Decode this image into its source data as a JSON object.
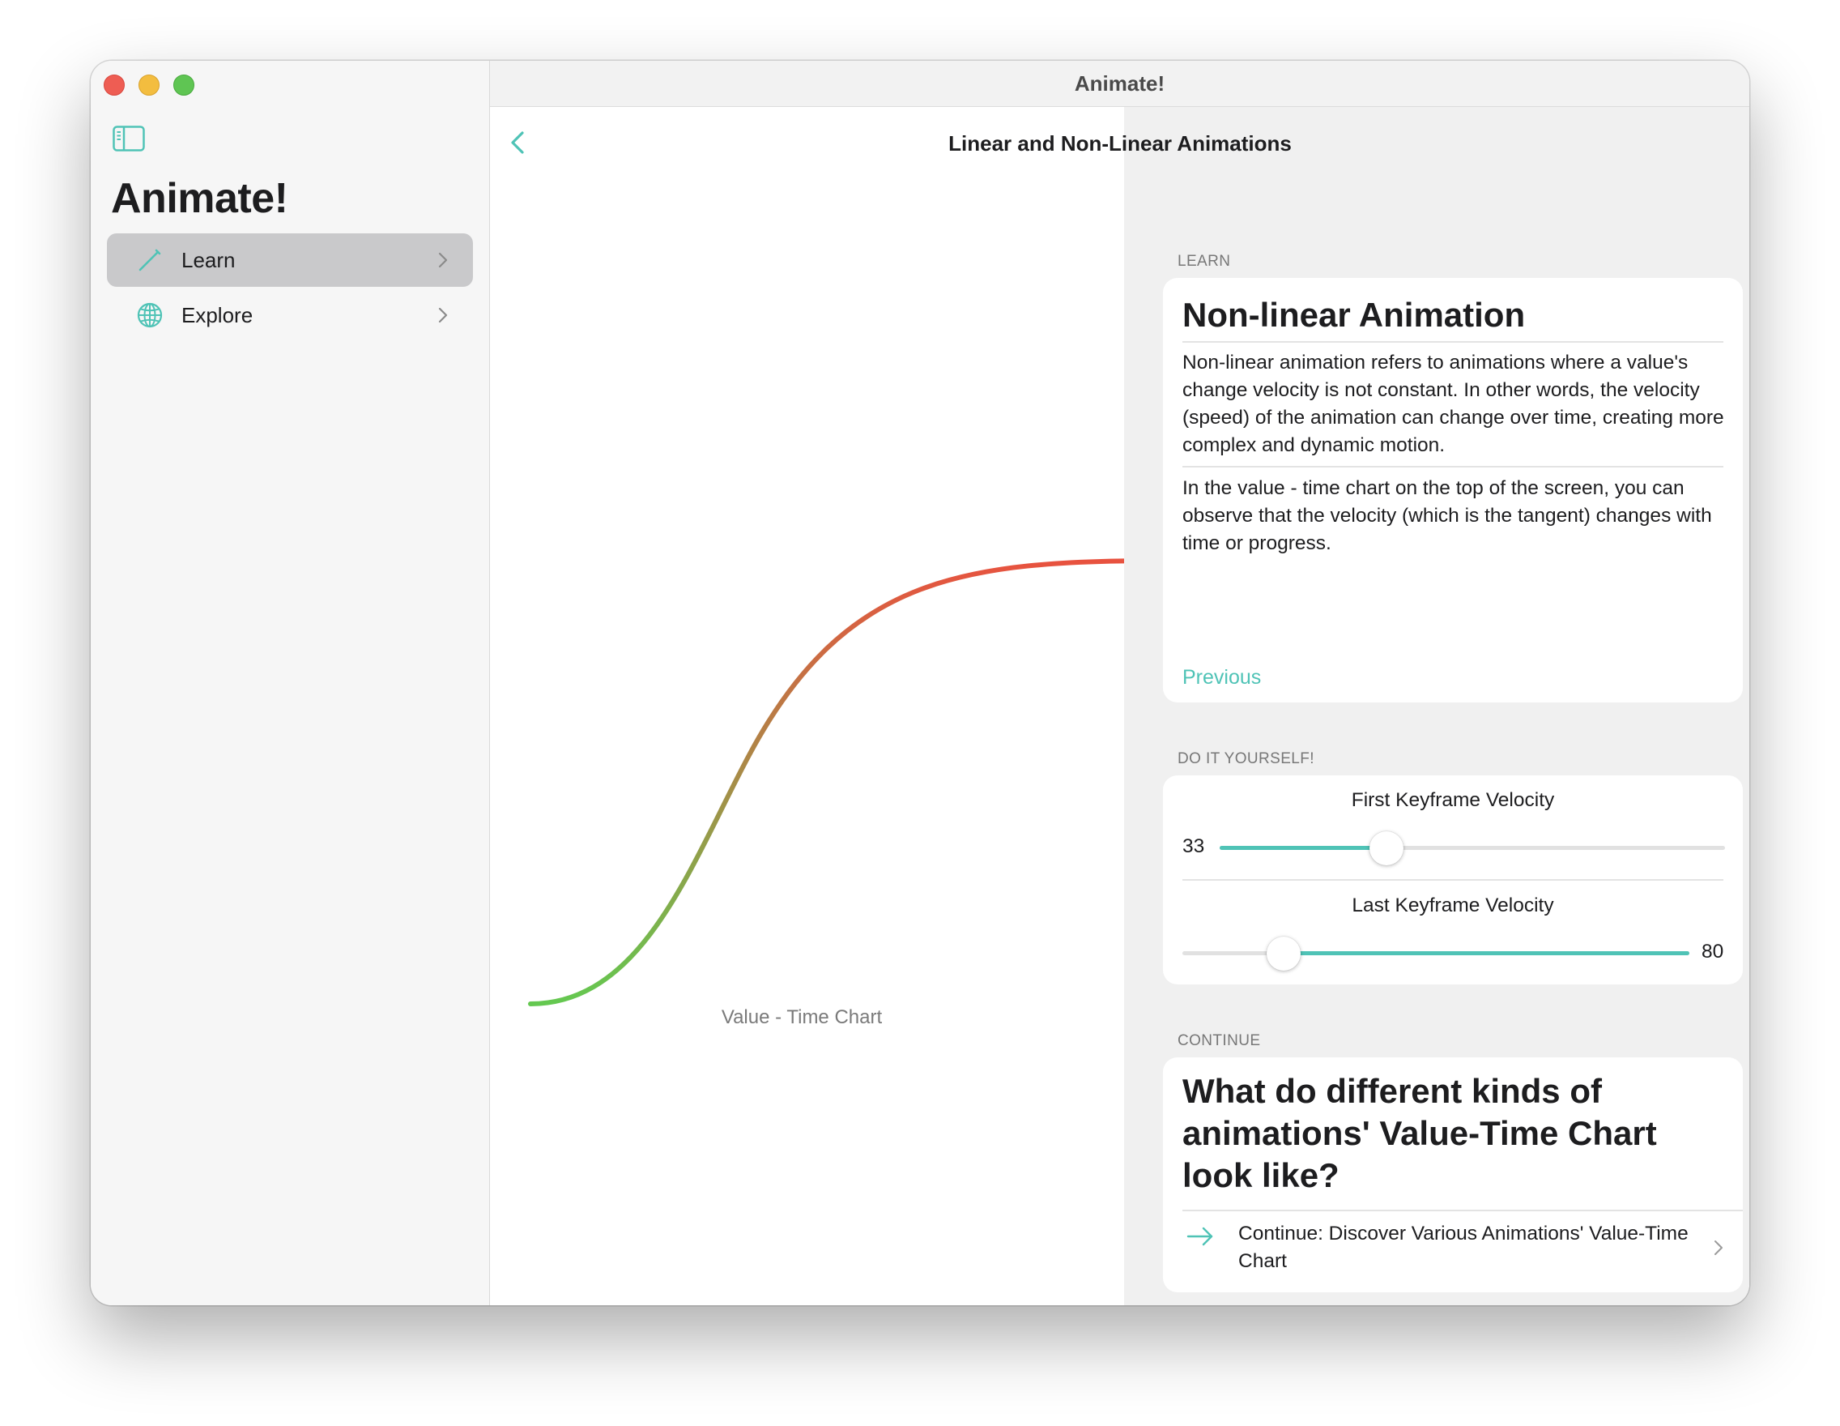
{
  "window": {
    "title": "Animate!"
  },
  "sidebar": {
    "app_title": "Animate!",
    "items": [
      {
        "label": "Learn",
        "icon": "pencil-icon",
        "selected": true
      },
      {
        "label": "Explore",
        "icon": "globe-icon",
        "selected": false
      }
    ]
  },
  "page": {
    "title": "Linear and Non-Linear Animations"
  },
  "chart": {
    "caption": "Value - Time Chart",
    "curve": "ease-in-out",
    "gradient_start": "#64c850",
    "gradient_end": "#e8523f"
  },
  "learn": {
    "section_label": "LEARN",
    "heading": "Non-linear Animation",
    "paragraph_1": "Non-linear animation refers to animations where a value's change velocity is not constant. In other words, the velocity (speed) of the animation can change over time, creating more complex and dynamic motion.",
    "paragraph_2": "In the value - time chart on the top of the screen, you can observe that the velocity (which is the tangent) changes with time or progress.",
    "previous_label": "Previous"
  },
  "diy": {
    "section_label": "DO IT YOURSELF!",
    "sliders": [
      {
        "title": "First Keyframe Velocity",
        "value": "33",
        "fraction": 0.33
      },
      {
        "title": "Last Keyframe Velocity",
        "value": "80",
        "fraction": 0.2
      }
    ]
  },
  "continue": {
    "section_label": "CONTINUE",
    "heading": "What do different kinds of animations' Value-Time Chart look like?",
    "link_label": "Continue: Discover Various Animations' Value-Time Chart"
  },
  "colors": {
    "accent": "#4fc3b6",
    "selected_row": "#c9c9cb"
  }
}
